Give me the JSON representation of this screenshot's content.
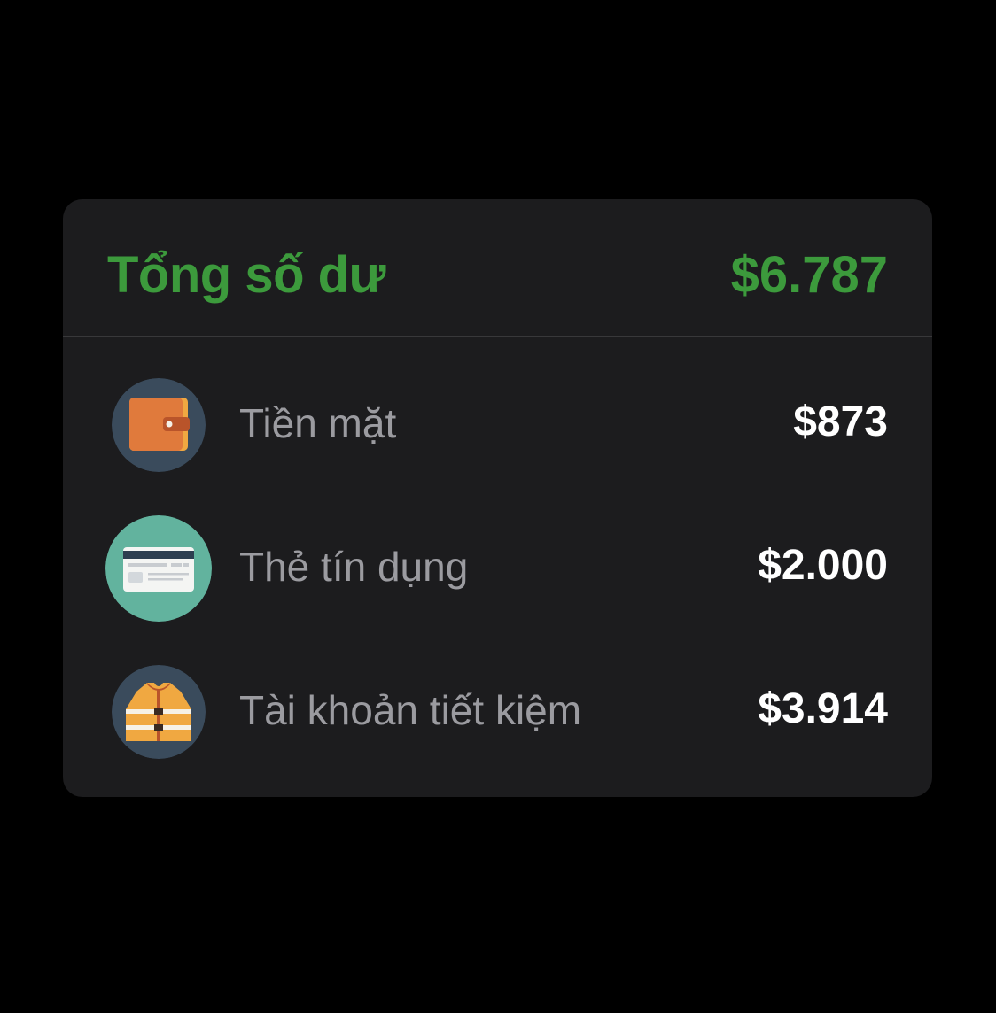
{
  "summary": {
    "title": "Tổng số dư",
    "total": "$6.787",
    "accent_color": "#3c9a3c"
  },
  "accounts": [
    {
      "label": "Tiền mặt",
      "amount": "$873",
      "icon": "wallet-icon",
      "icon_bg": "#3a4b5c"
    },
    {
      "label": "Thẻ tín dụng",
      "amount": "$2.000",
      "icon": "credit-card-icon",
      "icon_bg": "#62b39e"
    },
    {
      "label": "Tài khoản tiết kiệm",
      "amount": "$3.914",
      "icon": "life-vest-icon",
      "icon_bg": "#3a4b5c"
    }
  ]
}
